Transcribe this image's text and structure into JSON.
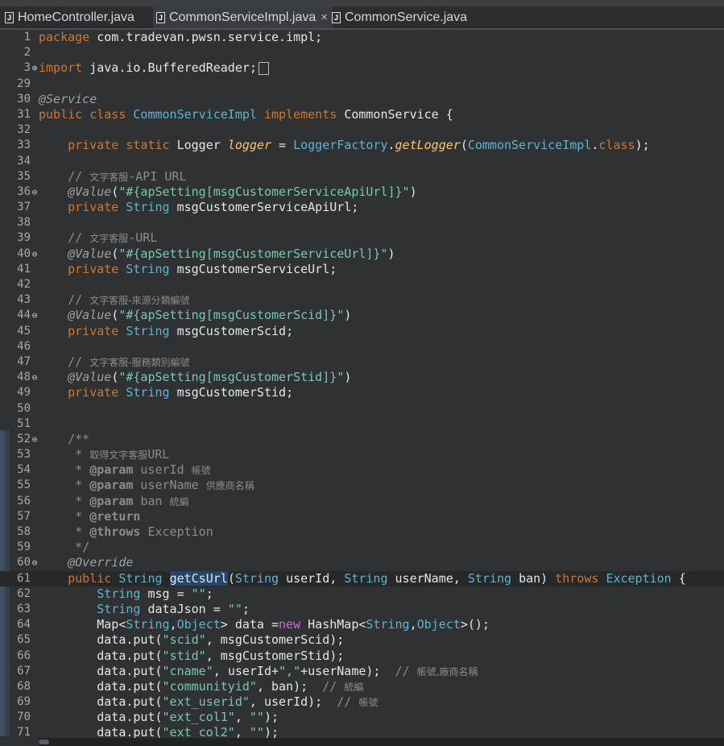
{
  "tabs": [
    {
      "label": "HomeController.java",
      "active": false
    },
    {
      "label": "CommonServiceImpl.java",
      "active": true,
      "close": "×"
    },
    {
      "label": "CommonService.java",
      "active": false
    }
  ],
  "lines": [
    {
      "n": "1",
      "m": "",
      "t": [
        [
          "kw",
          "package"
        ],
        [
          "p",
          " com.tradevan.pwsn.service.impl;"
        ]
      ]
    },
    {
      "n": "2",
      "m": "",
      "t": []
    },
    {
      "n": "3",
      "m": "⊕",
      "t": [
        [
          "kw",
          "import"
        ],
        [
          "p",
          " java.io.BufferedReader;"
        ],
        [
          "fold",
          ""
        ]
      ]
    },
    {
      "n": "29",
      "m": "",
      "t": []
    },
    {
      "n": "30",
      "m": "",
      "t": [
        [
          "an",
          "@Service"
        ]
      ]
    },
    {
      "n": "31",
      "m": "",
      "t": [
        [
          "kw",
          "public"
        ],
        [
          "p",
          " "
        ],
        [
          "kw",
          "class"
        ],
        [
          "p",
          " "
        ],
        [
          "ty",
          "CommonServiceImpl"
        ],
        [
          "p",
          " "
        ],
        [
          "kw",
          "implements"
        ],
        [
          "p",
          " "
        ],
        [
          "cls",
          "CommonService"
        ],
        [
          "p",
          " {"
        ]
      ]
    },
    {
      "n": "32",
      "m": "",
      "t": []
    },
    {
      "n": "33",
      "m": "",
      "t": [
        [
          "p",
          "    "
        ],
        [
          "kw",
          "private"
        ],
        [
          "p",
          " "
        ],
        [
          "kw",
          "static"
        ],
        [
          "p",
          " "
        ],
        [
          "cls",
          "Logger"
        ],
        [
          "p",
          " "
        ],
        [
          "sfld",
          "logger"
        ],
        [
          "p",
          " = "
        ],
        [
          "ty",
          "LoggerFactory"
        ],
        [
          "p",
          "."
        ],
        [
          "smeth",
          "getLogger"
        ],
        [
          "p",
          "("
        ],
        [
          "ty",
          "CommonServiceImpl"
        ],
        [
          "p",
          "."
        ],
        [
          "kw",
          "class"
        ],
        [
          "p",
          ");"
        ]
      ]
    },
    {
      "n": "34",
      "m": "",
      "t": []
    },
    {
      "n": "35",
      "m": "",
      "t": [
        [
          "p",
          "    "
        ],
        [
          "cm",
          "// "
        ],
        [
          "cmcjk",
          "文字客服"
        ],
        [
          "cm",
          "-API URL"
        ]
      ]
    },
    {
      "n": "36",
      "m": "⊖",
      "t": [
        [
          "p",
          "    "
        ],
        [
          "an",
          "@Value"
        ],
        [
          "p",
          "("
        ],
        [
          "str",
          "\"#{apSetting[msgCustomerServiceApiUrl]}\""
        ],
        [
          "p",
          ")"
        ]
      ]
    },
    {
      "n": "37",
      "m": "",
      "t": [
        [
          "p",
          "    "
        ],
        [
          "kw",
          "private"
        ],
        [
          "p",
          " "
        ],
        [
          "ty",
          "String"
        ],
        [
          "p",
          " "
        ],
        [
          "fld",
          "msgCustomerServiceApiUrl"
        ],
        [
          "p",
          ";"
        ]
      ]
    },
    {
      "n": "38",
      "m": "",
      "t": []
    },
    {
      "n": "39",
      "m": "",
      "t": [
        [
          "p",
          "    "
        ],
        [
          "cm",
          "// "
        ],
        [
          "cmcjk",
          "文字客服"
        ],
        [
          "cm",
          "-URL"
        ]
      ]
    },
    {
      "n": "40",
      "m": "⊖",
      "t": [
        [
          "p",
          "    "
        ],
        [
          "an",
          "@Value"
        ],
        [
          "p",
          "("
        ],
        [
          "str",
          "\"#{apSetting[msgCustomerServiceUrl]}\""
        ],
        [
          "p",
          ")"
        ]
      ]
    },
    {
      "n": "41",
      "m": "",
      "t": [
        [
          "p",
          "    "
        ],
        [
          "kw",
          "private"
        ],
        [
          "p",
          " "
        ],
        [
          "ty",
          "String"
        ],
        [
          "p",
          " "
        ],
        [
          "fld",
          "msgCustomerServiceUrl"
        ],
        [
          "p",
          ";"
        ]
      ]
    },
    {
      "n": "42",
      "m": "",
      "t": []
    },
    {
      "n": "43",
      "m": "",
      "t": [
        [
          "p",
          "    "
        ],
        [
          "cm",
          "// "
        ],
        [
          "cmcjk",
          "文字客服-來源分類編號"
        ]
      ]
    },
    {
      "n": "44",
      "m": "⊖",
      "t": [
        [
          "p",
          "    "
        ],
        [
          "an",
          "@Value"
        ],
        [
          "p",
          "("
        ],
        [
          "str",
          "\"#{apSetting[msgCustomerScid]}\""
        ],
        [
          "p",
          ")"
        ]
      ]
    },
    {
      "n": "45",
      "m": "",
      "t": [
        [
          "p",
          "    "
        ],
        [
          "kw",
          "private"
        ],
        [
          "p",
          " "
        ],
        [
          "ty",
          "String"
        ],
        [
          "p",
          " "
        ],
        [
          "fld",
          "msgCustomerScid"
        ],
        [
          "p",
          ";"
        ]
      ]
    },
    {
      "n": "46",
      "m": "",
      "t": []
    },
    {
      "n": "47",
      "m": "",
      "t": [
        [
          "p",
          "    "
        ],
        [
          "cm",
          "// "
        ],
        [
          "cmcjk",
          "文字客服-服務類別編號"
        ]
      ]
    },
    {
      "n": "48",
      "m": "⊖",
      "t": [
        [
          "p",
          "    "
        ],
        [
          "an",
          "@Value"
        ],
        [
          "p",
          "("
        ],
        [
          "str",
          "\"#{apSetting[msgCustomerStid]}\""
        ],
        [
          "p",
          ")"
        ]
      ]
    },
    {
      "n": "49",
      "m": "",
      "t": [
        [
          "p",
          "    "
        ],
        [
          "kw",
          "private"
        ],
        [
          "p",
          " "
        ],
        [
          "ty",
          "String"
        ],
        [
          "p",
          " "
        ],
        [
          "fld",
          "msgCustomerStid"
        ],
        [
          "p",
          ";"
        ]
      ]
    },
    {
      "n": "50",
      "m": "",
      "t": []
    },
    {
      "n": "51",
      "m": "",
      "t": []
    },
    {
      "n": "52",
      "m": "⊖",
      "t": [
        [
          "p",
          "    "
        ],
        [
          "cm",
          "/**"
        ]
      ]
    },
    {
      "n": "53",
      "m": "",
      "t": [
        [
          "p",
          "     "
        ],
        [
          "cm",
          "* "
        ],
        [
          "cmcjk",
          "取得文字客服"
        ],
        [
          "cm",
          "URL"
        ]
      ]
    },
    {
      "n": "54",
      "m": "",
      "t": [
        [
          "p",
          "     "
        ],
        [
          "cm",
          "* "
        ],
        [
          "cmb",
          "@param"
        ],
        [
          "cm",
          " userId "
        ],
        [
          "cmcjk",
          "帳號"
        ]
      ]
    },
    {
      "n": "55",
      "m": "",
      "t": [
        [
          "p",
          "     "
        ],
        [
          "cm",
          "* "
        ],
        [
          "cmb",
          "@param"
        ],
        [
          "cm",
          " userName "
        ],
        [
          "cmcjk",
          "供應商名稱"
        ]
      ]
    },
    {
      "n": "56",
      "m": "",
      "t": [
        [
          "p",
          "     "
        ],
        [
          "cm",
          "* "
        ],
        [
          "cmb",
          "@param"
        ],
        [
          "cm",
          " ban "
        ],
        [
          "cmcjk",
          "統編"
        ]
      ]
    },
    {
      "n": "57",
      "m": "",
      "t": [
        [
          "p",
          "     "
        ],
        [
          "cm",
          "* "
        ],
        [
          "cmb",
          "@return"
        ]
      ]
    },
    {
      "n": "58",
      "m": "",
      "t": [
        [
          "p",
          "     "
        ],
        [
          "cm",
          "* "
        ],
        [
          "cmb",
          "@throws"
        ],
        [
          "cm",
          " Exception"
        ]
      ]
    },
    {
      "n": "59",
      "m": "",
      "t": [
        [
          "p",
          "     "
        ],
        [
          "cm",
          "*/"
        ]
      ]
    },
    {
      "n": "60",
      "m": "⊖",
      "t": [
        [
          "p",
          "    "
        ],
        [
          "an",
          "@Override"
        ]
      ]
    },
    {
      "n": "61",
      "m": "",
      "cur": true,
      "t": [
        [
          "p",
          "    "
        ],
        [
          "kw",
          "public"
        ],
        [
          "p",
          " "
        ],
        [
          "ty",
          "String"
        ],
        [
          "p",
          " "
        ],
        [
          "hl",
          "getCsUrl"
        ],
        [
          "p",
          "("
        ],
        [
          "ty",
          "String"
        ],
        [
          "p",
          " "
        ],
        [
          "fld",
          "userId"
        ],
        [
          "p",
          ", "
        ],
        [
          "ty",
          "String"
        ],
        [
          "p",
          " "
        ],
        [
          "fld",
          "userName"
        ],
        [
          "p",
          ", "
        ],
        [
          "ty",
          "String"
        ],
        [
          "p",
          " "
        ],
        [
          "fld",
          "ban"
        ],
        [
          "p",
          ") "
        ],
        [
          "kw",
          "throws"
        ],
        [
          "p",
          " "
        ],
        [
          "ty",
          "Exception"
        ],
        [
          "p",
          " {"
        ]
      ]
    },
    {
      "n": "62",
      "m": "",
      "t": [
        [
          "p",
          "        "
        ],
        [
          "ty",
          "String"
        ],
        [
          "p",
          " "
        ],
        [
          "fld",
          "msg"
        ],
        [
          "p",
          " = "
        ],
        [
          "str",
          "\"\""
        ],
        [
          "p",
          ";"
        ]
      ]
    },
    {
      "n": "63",
      "m": "",
      "t": [
        [
          "p",
          "        "
        ],
        [
          "ty",
          "String"
        ],
        [
          "p",
          " "
        ],
        [
          "fld",
          "dataJson"
        ],
        [
          "p",
          " = "
        ],
        [
          "str",
          "\"\""
        ],
        [
          "p",
          ";"
        ]
      ]
    },
    {
      "n": "64",
      "m": "",
      "t": [
        [
          "p",
          "        "
        ],
        [
          "cls",
          "Map"
        ],
        [
          "p",
          "<"
        ],
        [
          "ty",
          "String"
        ],
        [
          "p",
          ","
        ],
        [
          "ty",
          "Object"
        ],
        [
          "p",
          "> "
        ],
        [
          "fld",
          "data"
        ],
        [
          "p",
          " ="
        ],
        [
          "kwp",
          "new"
        ],
        [
          "p",
          " "
        ],
        [
          "cls",
          "HashMap"
        ],
        [
          "p",
          "<"
        ],
        [
          "ty",
          "String"
        ],
        [
          "p",
          ","
        ],
        [
          "ty",
          "Object"
        ],
        [
          "p",
          ">();"
        ]
      ]
    },
    {
      "n": "65",
      "m": "",
      "t": [
        [
          "p",
          "        "
        ],
        [
          "fld",
          "data"
        ],
        [
          "p",
          ".put("
        ],
        [
          "str",
          "\"scid\""
        ],
        [
          "p",
          ", "
        ],
        [
          "fld",
          "msgCustomerScid"
        ],
        [
          "p",
          ");"
        ]
      ]
    },
    {
      "n": "66",
      "m": "",
      "t": [
        [
          "p",
          "        "
        ],
        [
          "fld",
          "data"
        ],
        [
          "p",
          ".put("
        ],
        [
          "str",
          "\"stid\""
        ],
        [
          "p",
          ", "
        ],
        [
          "fld",
          "msgCustomerStid"
        ],
        [
          "p",
          ");"
        ]
      ]
    },
    {
      "n": "67",
      "m": "",
      "t": [
        [
          "p",
          "        "
        ],
        [
          "fld",
          "data"
        ],
        [
          "p",
          ".put("
        ],
        [
          "str",
          "\"cname\""
        ],
        [
          "p",
          ", "
        ],
        [
          "fld",
          "userId"
        ],
        [
          "p",
          "+"
        ],
        [
          "str",
          "\",\""
        ],
        [
          "p",
          "+"
        ],
        [
          "fld",
          "userName"
        ],
        [
          "p",
          ");  "
        ],
        [
          "cm",
          "// "
        ],
        [
          "cmcjk",
          "帳號,廠商名稱"
        ]
      ]
    },
    {
      "n": "68",
      "m": "",
      "t": [
        [
          "p",
          "        "
        ],
        [
          "fld",
          "data"
        ],
        [
          "p",
          ".put("
        ],
        [
          "str",
          "\"communityid\""
        ],
        [
          "p",
          ", "
        ],
        [
          "fld",
          "ban"
        ],
        [
          "p",
          ");  "
        ],
        [
          "cm",
          "// "
        ],
        [
          "cmcjk",
          "統編"
        ]
      ]
    },
    {
      "n": "69",
      "m": "",
      "t": [
        [
          "p",
          "        "
        ],
        [
          "fld",
          "data"
        ],
        [
          "p",
          ".put("
        ],
        [
          "str",
          "\"ext_userid\""
        ],
        [
          "p",
          ", "
        ],
        [
          "fld",
          "userId"
        ],
        [
          "p",
          ");  "
        ],
        [
          "cm",
          "// "
        ],
        [
          "cmcjk",
          "帳號"
        ]
      ]
    },
    {
      "n": "70",
      "m": "",
      "t": [
        [
          "p",
          "        "
        ],
        [
          "fld",
          "data"
        ],
        [
          "p",
          ".put("
        ],
        [
          "str",
          "\"ext_col1\""
        ],
        [
          "p",
          ", "
        ],
        [
          "str",
          "\"\""
        ],
        [
          "p",
          ");"
        ]
      ]
    },
    {
      "n": "71",
      "m": "",
      "t": [
        [
          "p",
          "        "
        ],
        [
          "fld",
          "data"
        ],
        [
          "p",
          ".put("
        ],
        [
          "str",
          "\"ext_col2\""
        ],
        [
          "p",
          ", "
        ],
        [
          "str",
          "\"\""
        ],
        [
          "p",
          ");"
        ]
      ]
    }
  ]
}
